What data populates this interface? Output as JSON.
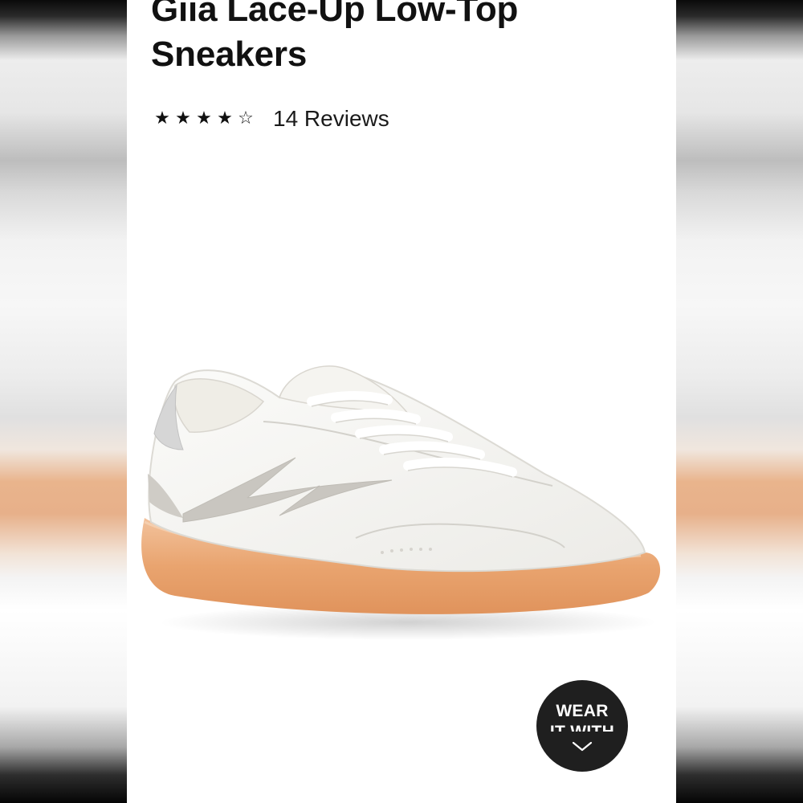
{
  "product": {
    "title_line1": "Giia Lace-Up Low-Top",
    "title_line2": "Sneakers",
    "rating": 4,
    "rating_max": 5,
    "reviews_label": "14 Reviews",
    "image_icon": "white-sneaker-gum-sole-image"
  },
  "wear_it_with": {
    "line1": "WEAR",
    "line2": "IT WITH",
    "icon": "chevron-down-icon"
  },
  "colors": {
    "background": "#ffffff",
    "text": "#111111",
    "badge": "#1f1f1f",
    "sole": "#e9a46f"
  }
}
